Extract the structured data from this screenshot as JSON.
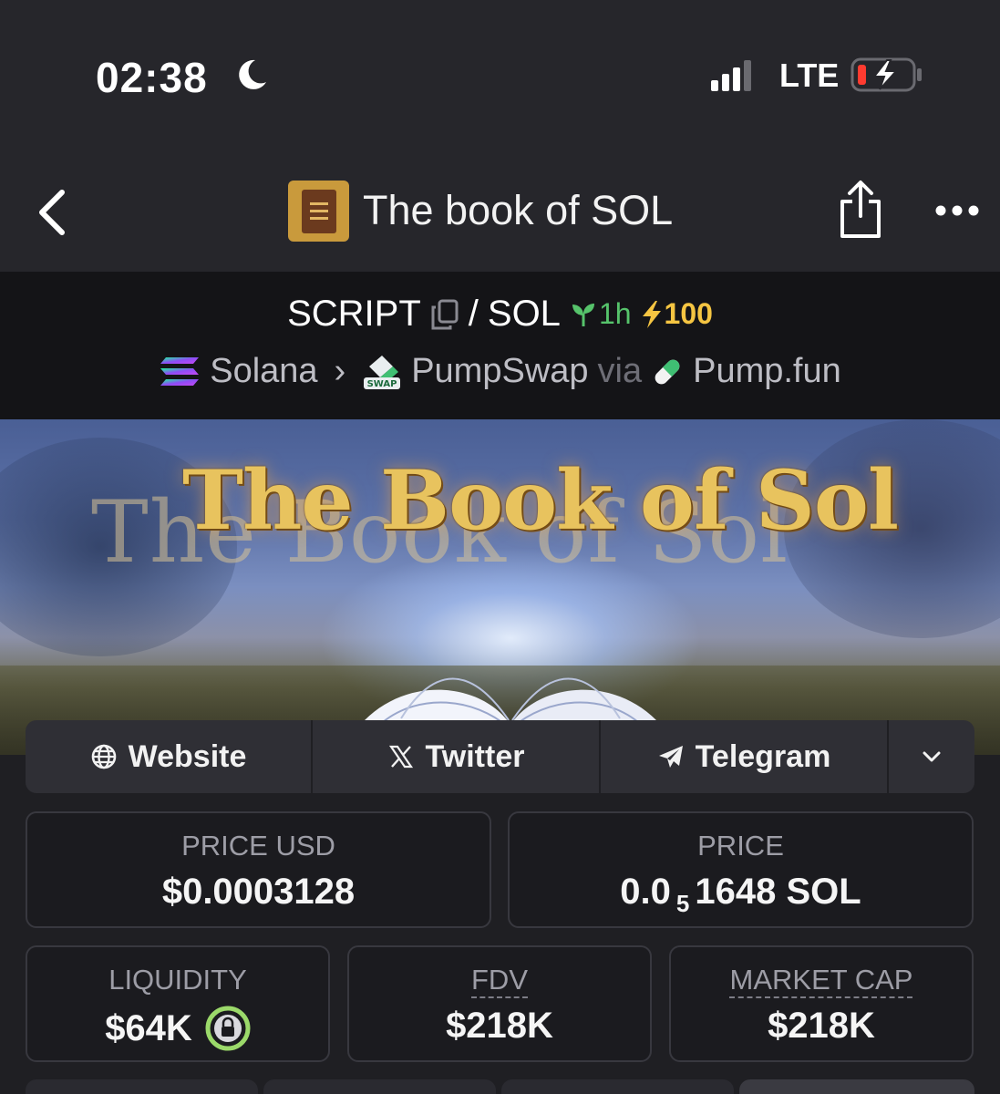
{
  "status_bar": {
    "time": "02:38",
    "network": "LTE"
  },
  "nav": {
    "title": "The book of SOL"
  },
  "pair": {
    "base": "SCRIPT",
    "separator": "/",
    "quote": "SOL",
    "age": "1h",
    "boosts": "100",
    "chain": "Solana",
    "dex": "PumpSwap",
    "via_label": "via",
    "launchpad": "Pump.fun"
  },
  "banner": {
    "title": "The Book of Sol"
  },
  "socials": [
    {
      "label": "Website",
      "icon": "globe-icon"
    },
    {
      "label": "Twitter",
      "icon": "x-icon"
    },
    {
      "label": "Telegram",
      "icon": "telegram-icon"
    }
  ],
  "stats": {
    "price_usd": {
      "label": "PRICE USD",
      "value": "$0.0003128"
    },
    "price": {
      "label": "PRICE",
      "value_prefix": "0.0",
      "value_subscript": "5",
      "value_suffix": "1648 SOL"
    },
    "liquidity": {
      "label": "LIQUIDITY",
      "value": "$64K"
    },
    "fdv": {
      "label": "FDV",
      "value": "$218K"
    },
    "market_cap": {
      "label": "MARKET CAP",
      "value": "$218K"
    }
  },
  "colors": {
    "accent_green": "#56c36b",
    "boost_yellow": "#f5c542",
    "lock_green": "#9bd96a"
  }
}
